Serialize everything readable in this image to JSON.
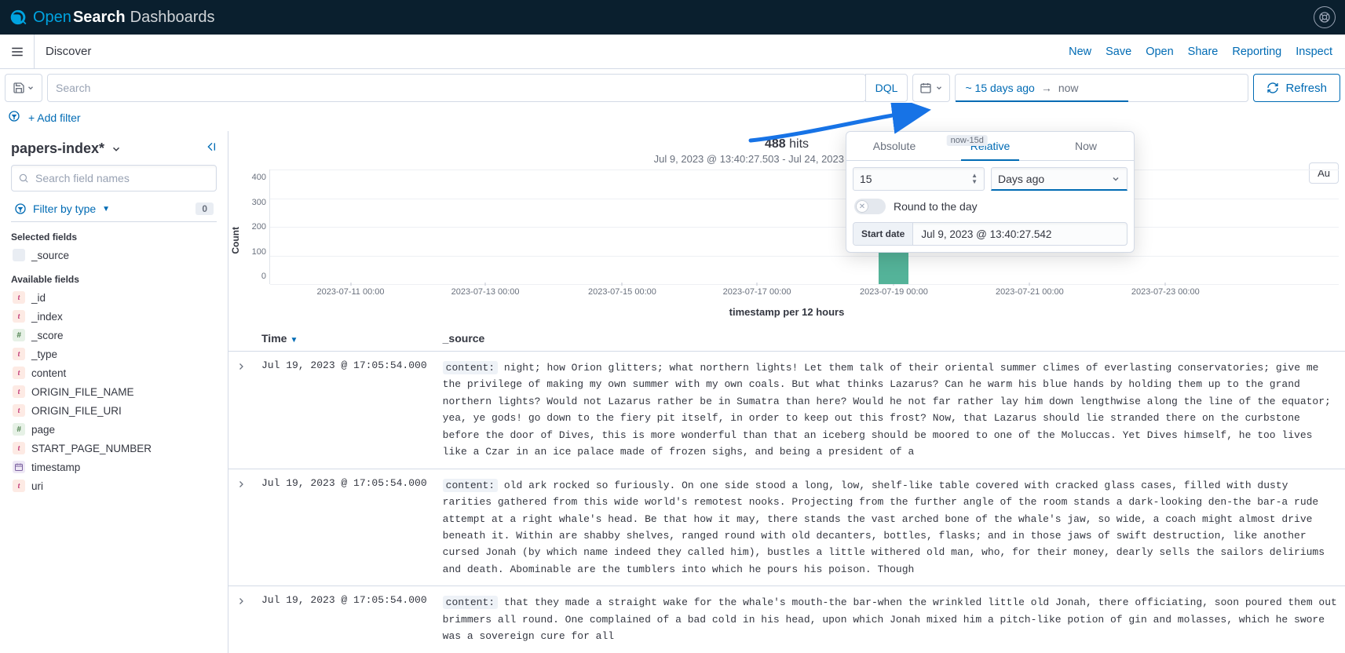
{
  "brand": {
    "open": "Open",
    "search": "Search",
    "dash": "Dashboards"
  },
  "app_title": "Discover",
  "app_actions": {
    "new": "New",
    "save": "Save",
    "open": "Open",
    "share": "Share",
    "reporting": "Reporting",
    "inspect": "Inspect"
  },
  "query": {
    "search_placeholder": "Search",
    "dql": "DQL",
    "range_from": "~ 15 days ago",
    "range_to": "now",
    "refresh": "Refresh"
  },
  "filter": {
    "add": "+ Add filter"
  },
  "sidebar": {
    "index_pattern": "papers-index*",
    "field_search_placeholder": "Search field names",
    "filter_by_type": "Filter by type",
    "type_count": "0",
    "selected_label": "Selected fields",
    "available_label": "Available fields",
    "selected": [
      {
        "name": "_source",
        "ftype": "src",
        "glyph": "</>"
      }
    ],
    "available": [
      {
        "name": "_id",
        "ftype": "t",
        "glyph": "t"
      },
      {
        "name": "_index",
        "ftype": "t",
        "glyph": "t"
      },
      {
        "name": "_score",
        "ftype": "h",
        "glyph": "#"
      },
      {
        "name": "_type",
        "ftype": "t",
        "glyph": "t"
      },
      {
        "name": "content",
        "ftype": "t",
        "glyph": "t"
      },
      {
        "name": "ORIGIN_FILE_NAME",
        "ftype": "t",
        "glyph": "t"
      },
      {
        "name": "ORIGIN_FILE_URI",
        "ftype": "t",
        "glyph": "t"
      },
      {
        "name": "page",
        "ftype": "h",
        "glyph": "#"
      },
      {
        "name": "START_PAGE_NUMBER",
        "ftype": "t",
        "glyph": "t"
      },
      {
        "name": "timestamp",
        "ftype": "date",
        "glyph": ""
      },
      {
        "name": "uri",
        "ftype": "t",
        "glyph": "t"
      }
    ]
  },
  "hits": {
    "count": "488",
    "label": "hits"
  },
  "subrange": "Jul 9, 2023 @ 13:40:27.503 - Jul 24, 2023 @ 13:40:27.503",
  "auto_label": "Au",
  "chart_data": {
    "type": "bar",
    "ylabel": "Count",
    "xlabel": "timestamp per 12 hours",
    "ytick": [
      "400",
      "300",
      "200",
      "100",
      "0"
    ],
    "ylim": [
      0,
      420
    ],
    "xtick": [
      "2023-07-11 00:00",
      "2023-07-13 00:00",
      "2023-07-15 00:00",
      "2023-07-17 00:00",
      "2023-07-19 00:00",
      "2023-07-21 00:00",
      "2023-07-23 00:00"
    ],
    "categories": [
      "2023-07-19 12:00"
    ],
    "values": [
      488
    ],
    "series": [
      {
        "name": "Count",
        "values": [
          488
        ]
      }
    ],
    "bar_left_pct": 57.0,
    "xtick_pct": [
      7.6,
      20.2,
      33.0,
      45.6,
      58.4,
      71.1,
      83.8
    ]
  },
  "table": {
    "headers": {
      "time": "Time",
      "source": "_source"
    },
    "rows": [
      {
        "time": "Jul 19, 2023 @ 17:05:54.000",
        "key": "content:",
        "val": "night; how Orion glitters; what northern lights! Let them talk of their oriental summer climes of everlasting conservatories; give me the privilege of making my own summer with my own coals. But what thinks Lazarus? Can he warm his blue hands by holding them up to the grand northern lights? Would not Lazarus rather be in Sumatra than here? Would he not far rather lay him down lengthwise along the line of the equator; yea, ye gods! go down to the fiery pit itself, in order to keep out this frost? Now, that Lazarus should lie stranded there on the curbstone before the door of Dives, this is more wonderful than that an iceberg should be moored to one of the Moluccas. Yet Dives himself, he too lives like a Czar in an ice palace made of frozen sighs, and being a president of a"
      },
      {
        "time": "Jul 19, 2023 @ 17:05:54.000",
        "key": "content:",
        "val": "old ark rocked so furiously. On one side stood a long, low, shelf-like table covered with cracked glass cases, filled with dusty rarities gathered from this wide world's remotest nooks. Projecting from the further angle of the room stands a dark-looking den-the bar-a rude attempt at a right whale's head. Be that how it may, there stands the vast arched bone of the whale's jaw, so wide, a coach might almost drive beneath it. Within are shabby shelves, ranged round with old decanters, bottles, flasks; and in those jaws of swift destruction, like another cursed Jonah (by which name indeed they called him), bustles a little withered old man, who, for their money, dearly sells the sailors deliriums and death. Abominable are the tumblers into which he pours his poison. Though"
      },
      {
        "time": "Jul 19, 2023 @ 17:05:54.000",
        "key": "content:",
        "val": "that they made a straight wake for the whale's mouth-the bar-when the wrinkled little old Jonah, there officiating, soon poured them out brimmers all round. One complained of a bad cold in his head, upon which Jonah mixed him a pitch-like potion of gin and molasses, which he swore was a sovereign cure for all"
      }
    ]
  },
  "popover": {
    "tabs": {
      "absolute": "Absolute",
      "relative": "Relative",
      "now": "Now"
    },
    "rel_badge": "now-15d",
    "amount": "15",
    "unit": "Days ago",
    "round": "Round to the day",
    "start_label": "Start date",
    "start_value": "Jul 9, 2023 @ 13:40:27.542"
  }
}
